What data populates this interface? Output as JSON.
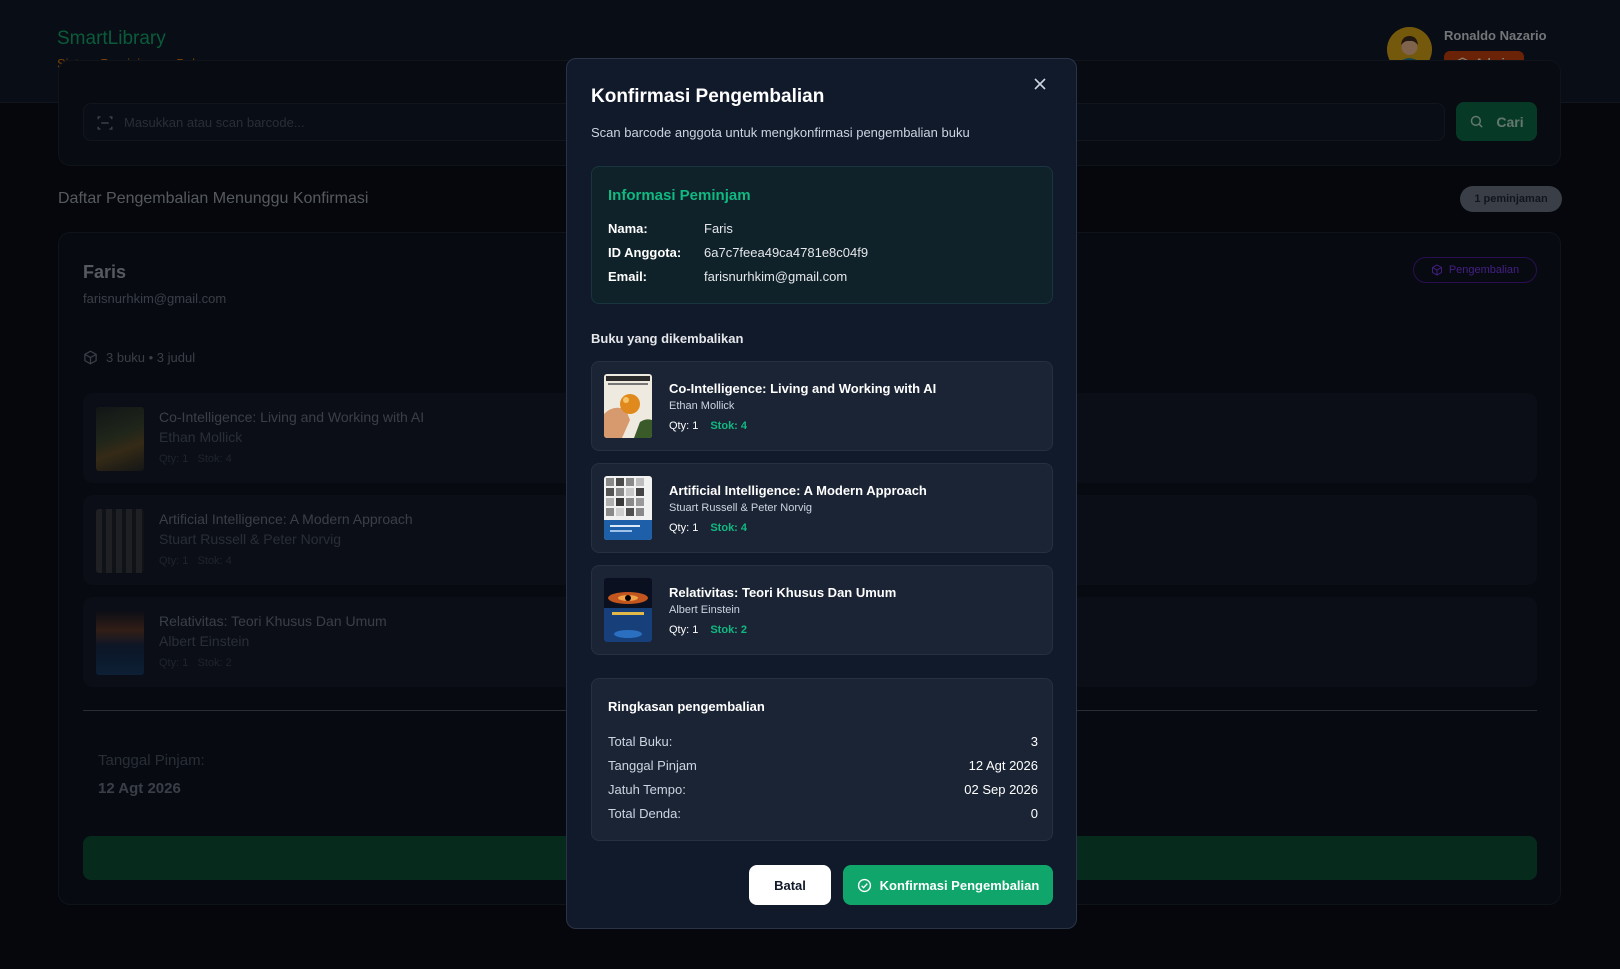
{
  "header": {
    "app_title": "SmartLibrary",
    "app_subtitle": "Sistem Peminjaman Buku",
    "user_name": "Ronaldo Nazario",
    "user_role": "Admin"
  },
  "search": {
    "placeholder": "Masukkan atau scan barcode...",
    "button_label": "Cari"
  },
  "list": {
    "title": "Daftar Pengembalian Menunggu Konfirmasi",
    "count_label": "1 peminjaman"
  },
  "loan": {
    "borrower_name": "Faris",
    "borrower_email": "farisnurhkim@gmail.com",
    "status_label": "Pengembalian",
    "books_summary": "3 buku • 3 judul",
    "books": [
      {
        "title": "Co-Intelligence: Living and Working with AI",
        "author": "Ethan Mollick",
        "qty": "Qty: 1",
        "stock": "Stok: 4"
      },
      {
        "title": "Artificial Intelligence: A Modern Approach",
        "author": "Stuart Russell & Peter Norvig",
        "qty": "Qty: 1",
        "stock": "Stok: 4"
      },
      {
        "title": "Relativitas: Teori Khusus Dan Umum",
        "author": "Albert Einstein",
        "qty": "Qty: 1",
        "stock": "Stok: 2"
      }
    ],
    "borrow_date_label": "Tanggal Pinjam:",
    "borrow_date_value": "12 Agt 2026"
  },
  "modal": {
    "title": "Konfirmasi Pengembalian",
    "subtitle": "Scan barcode anggota untuk mengkonfirmasi pengembalian buku",
    "info": {
      "title": "Informasi Peminjam",
      "name_label": "Nama:",
      "name_value": "Faris",
      "id_label": "ID Anggota:",
      "id_value": "6a7c7feea49ca4781e8c04f9",
      "email_label": "Email:",
      "email_value": "farisnurhkim@gmail.com"
    },
    "books_label": "Buku yang dikembalikan",
    "books": [
      {
        "title": "Co-Intelligence: Living and Working with AI",
        "author": "Ethan Mollick",
        "qty": "Qty: 1",
        "stock": "Stok: 4"
      },
      {
        "title": "Artificial Intelligence: A Modern Approach",
        "author": "Stuart Russell & Peter Norvig",
        "qty": "Qty: 1",
        "stock": "Stok: 4"
      },
      {
        "title": "Relativitas: Teori Khusus Dan Umum",
        "author": "Albert Einstein",
        "qty": "Qty: 1",
        "stock": "Stok: 2"
      }
    ],
    "summary": {
      "title": "Ringkasan pengembalian",
      "rows": [
        {
          "label": "Total Buku:",
          "value": "3"
        },
        {
          "label": "Tanggal Pinjam",
          "value": "12 Agt 2026"
        },
        {
          "label": "Jatuh Tempo:",
          "value": "02 Sep 2026"
        },
        {
          "label": "Total Denda:",
          "value": "0"
        }
      ]
    },
    "cancel_label": "Batal",
    "confirm_label": "Konfirmasi Pengembalian"
  },
  "colors": {
    "accent_green": "#10a66b",
    "brand_green": "#15a46a",
    "brand_orange": "#d97706",
    "admin_badge": "#c2410c",
    "status_purple": "#7c3aed"
  },
  "icons": [
    "scan-icon",
    "search-icon",
    "shield-icon",
    "box-icon",
    "close-icon",
    "check-circle-icon"
  ]
}
